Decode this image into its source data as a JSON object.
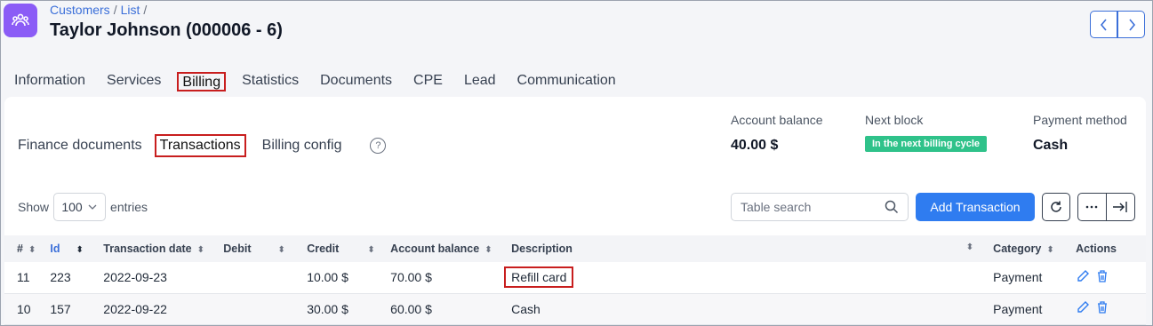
{
  "breadcrumb": {
    "item1": "Customers",
    "item2": "List",
    "sep": "/"
  },
  "title": "Taylor Johnson (000006 - 6)",
  "tabs": [
    "Information",
    "Services",
    "Billing",
    "Statistics",
    "Documents",
    "CPE",
    "Lead",
    "Communication"
  ],
  "subtabs": {
    "finance": "Finance documents",
    "transactions": "Transactions",
    "billing_config": "Billing config",
    "help": "?"
  },
  "summary": {
    "balance_label": "Account balance",
    "balance_value": "40.00 $",
    "next_block_label": "Next block",
    "next_block_value": "In the next billing cycle",
    "payment_label": "Payment method",
    "payment_value": "Cash"
  },
  "entries": {
    "show": "Show",
    "count": "100",
    "suffix": "entries"
  },
  "search": {
    "placeholder": "Table search"
  },
  "add_button": "Add Transaction",
  "table": {
    "headers": [
      "#",
      "Id",
      "Transaction date",
      "Debit",
      "Credit",
      "Account balance",
      "Description",
      "Category",
      "Actions"
    ],
    "rows": [
      {
        "num": "11",
        "id": "223",
        "date": "2022-09-23",
        "debit": "",
        "credit": "10.00 $",
        "balance": "70.00 $",
        "description": "Refill card",
        "category": "Payment"
      },
      {
        "num": "10",
        "id": "157",
        "date": "2022-09-22",
        "debit": "",
        "credit": "30.00 $",
        "balance": "60.00 $",
        "description": "Cash",
        "category": "Payment"
      }
    ]
  },
  "colors": {
    "accent": "#2f7cf0",
    "brand": "#8b5cf6",
    "highlight": "#c81e1e",
    "badge": "#2fc28a"
  }
}
